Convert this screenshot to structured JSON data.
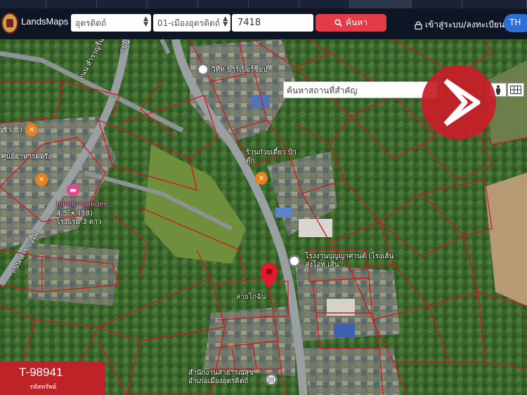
{
  "header": {
    "brand": "LandsMaps",
    "province_select": "อุตรดิตถ์",
    "district_select": "01-เมืองอุตรดิตถ์",
    "parcel_number": "7418",
    "search_label": "ค้นหา",
    "login_label": "เข้าสู่ระบบ/ลงทะเบียน",
    "language": "TH"
  },
  "map": {
    "place_search_value": "ค้นหาสถานที่สำคัญ",
    "road_labels": [
      "ถนน สำราญรื่น",
      "ถนน สำราญรื่น",
      "ถนน เจษ"
    ],
    "places": [
      {
        "name": "วิทิท บาร์เบอร์ช็อป",
        "icon": "place-icon"
      },
      {
        "name": "ชิว ชิว",
        "icon": "restaurant-icon"
      },
      {
        "name": "ศูนย์อาหารดอรัง",
        "icon": "restaurant-icon"
      },
      {
        "name": "ร้านก๋วยเตี๋ยว ป้าตุ๊ก",
        "icon": "restaurant-icon"
      },
      {
        "name": "Jongluxpakdee",
        "rating": "4.5",
        "reviews": "(38)",
        "category": "โรงแรม 3 ดาว",
        "icon": "hotel-icon"
      },
      {
        "name": "โรงงานบุญญาศานต์ (โรงเส้นสูงโอท เส้น...",
        "icon": "place-icon"
      },
      {
        "name": "สำนักงานสาธารณสุข อำเภอเมืองอุตรดิตถ์",
        "icon": "government-icon"
      },
      {
        "name": "ลายโกฉัน",
        "icon": "place-icon"
      }
    ]
  },
  "badge": {
    "code": "T-98941",
    "caption": "รหัสทรัพย์"
  },
  "colors": {
    "header_bg": "#0e1524",
    "search_button": "#e33b48",
    "lang_button": "#2c6fd6",
    "badge": "#c81e28",
    "parcel_lines": "#d01818",
    "road": "#9aa0a2",
    "vegetation": "#3e6a2e"
  }
}
